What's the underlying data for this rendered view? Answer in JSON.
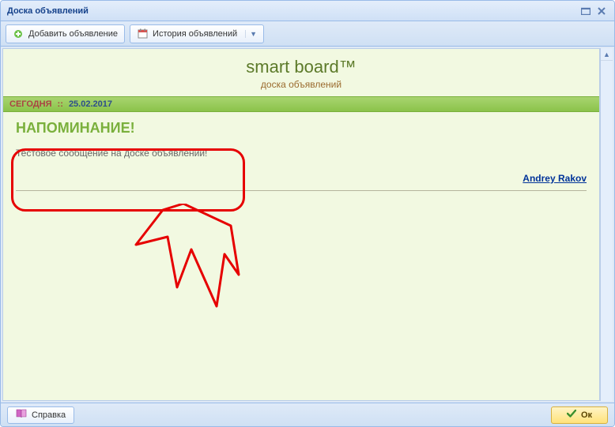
{
  "window": {
    "title": "Доска объявлений"
  },
  "toolbar": {
    "add_label": "Добавить объявление",
    "history_label": "История объявлений"
  },
  "board": {
    "title": "smart board™",
    "subtitle": "доска объявлений",
    "date_label": "СЕГОДНЯ",
    "date_value": "25.02.2017"
  },
  "post": {
    "title": "НАПОМИНАНИЕ!",
    "body": "Тестовое сообщение на доске объявлений!",
    "author": "Andrey Rakov"
  },
  "footer": {
    "help_label": "Справка",
    "ok_label": "Ок"
  }
}
